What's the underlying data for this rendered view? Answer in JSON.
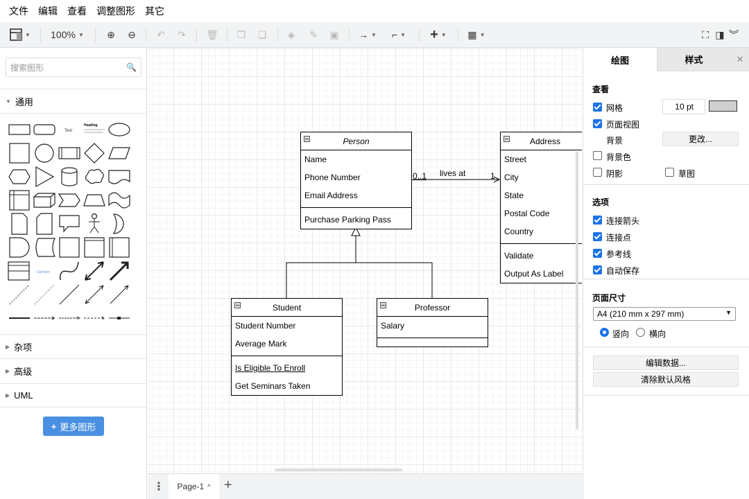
{
  "menu": [
    "文件",
    "编辑",
    "查看",
    "调整图形",
    "其它"
  ],
  "toolbar": {
    "zoom": "100%",
    "icons": [
      "format-panel-icon",
      "zoom-in-icon",
      "zoom-out-icon",
      "undo-icon",
      "redo-icon",
      "delete-icon",
      "to-front-icon",
      "to-back-icon",
      "fill-color-icon",
      "line-color-icon",
      "shadow-icon",
      "connection-icon",
      "waypoints-icon",
      "insert-icon",
      "table-icon",
      "fullscreen-icon",
      "toggle-panel-icon",
      "collapse-icon"
    ]
  },
  "left": {
    "search_placeholder": "搜索图形",
    "general": "通用",
    "sections": [
      "杂项",
      "高级",
      "UML"
    ],
    "more_shapes": "更多图形"
  },
  "diagram": {
    "person": {
      "name": "Person",
      "attributes": [
        "Name",
        "Phone Number",
        "Email Address"
      ],
      "methods": [
        "Purchase Parking Pass"
      ]
    },
    "address": {
      "name": "Address",
      "attributes": [
        "Street",
        "City",
        "State",
        "Postal Code",
        "Country"
      ],
      "methods": [
        "Validate",
        "Output As Label"
      ]
    },
    "student": {
      "name": "Student",
      "attributes": [
        "Student Number",
        "Average Mark"
      ],
      "methods": [
        "Is Eligible To Enroll",
        "Get Seminars Taken"
      ]
    },
    "professor": {
      "name": "Professor",
      "attributes": [
        "Salary"
      ],
      "methods": []
    },
    "association": {
      "label": "lives at",
      "source_mult": "0..1",
      "target_mult": "1"
    }
  },
  "bottom": {
    "page": "Page-1"
  },
  "right": {
    "tabs": [
      "绘图",
      "样式"
    ],
    "view": {
      "title": "查看",
      "grid": "网格",
      "grid_size": "10 pt",
      "page_view": "页面视图",
      "background": "背景",
      "change": "更改...",
      "bg_color": "背景色",
      "shadow": "阴影",
      "sketch": "草图",
      "grid_checked": true,
      "page_view_checked": true,
      "bg_color_checked": false,
      "shadow_checked": false,
      "sketch_checked": false
    },
    "options": {
      "title": "选项",
      "items": [
        {
          "label": "连接箭头",
          "checked": true
        },
        {
          "label": "连接点",
          "checked": true
        },
        {
          "label": "参考线",
          "checked": true
        },
        {
          "label": "自动保存",
          "checked": true
        }
      ]
    },
    "page_size": {
      "title": "页面尺寸",
      "value": "A4 (210 mm x 297 mm)",
      "portrait": "竖向",
      "landscape": "横向",
      "orientation": "portrait"
    },
    "edit_data": "编辑数据...",
    "clear_style": "清除默认风格"
  }
}
